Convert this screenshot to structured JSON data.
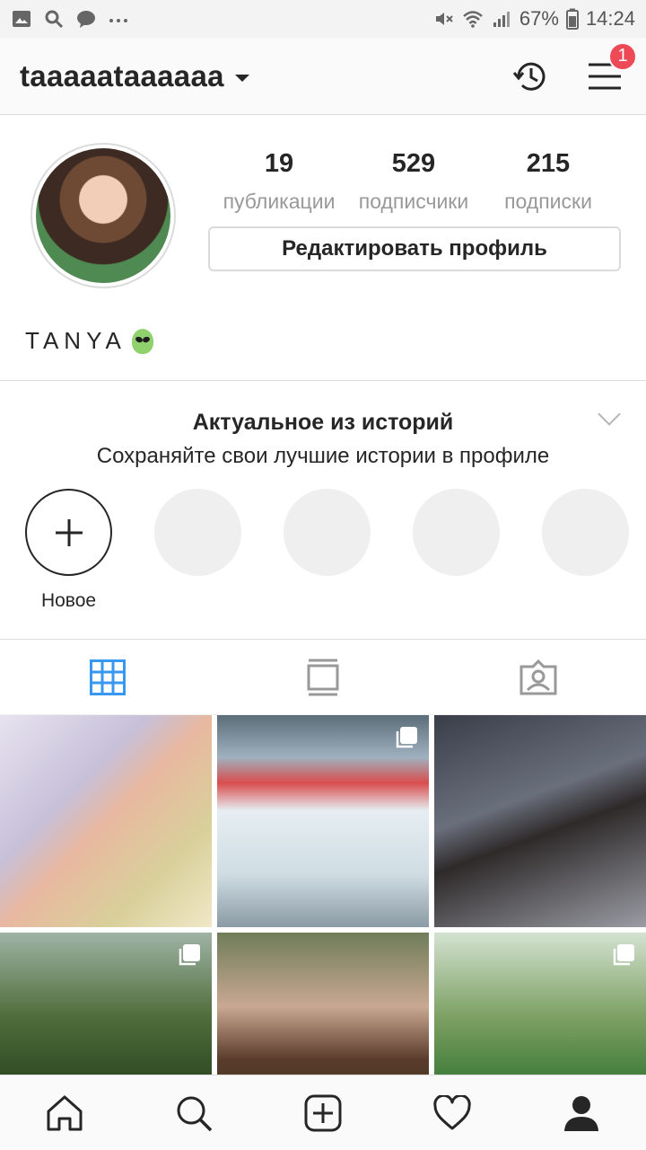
{
  "status_bar": {
    "battery": "67%",
    "time": "14:24",
    "icons": [
      "gallery-icon",
      "search-icon",
      "chat-icon",
      "more-icon",
      "mute-icon",
      "wifi-icon",
      "signal-icon",
      "battery-icon"
    ]
  },
  "header": {
    "username": "taaaaataaaaaa",
    "notification_badge": "1",
    "icons": [
      "archive-icon",
      "menu-icon"
    ]
  },
  "profile": {
    "stats": [
      {
        "value": "19",
        "label": "публикации"
      },
      {
        "value": "529",
        "label": "подписчики"
      },
      {
        "value": "215",
        "label": "подписки"
      }
    ],
    "edit_button": "Редактировать профиль",
    "bio_name": "TANYA"
  },
  "highlights": {
    "title": "Актуальное из историй",
    "subtitle": "Сохраняйте свои лучшие истории в профиле",
    "new_label": "Новое"
  },
  "tabs": [
    "grid-icon",
    "feed-icon",
    "tagged-icon"
  ],
  "bottom_nav": [
    "home-icon",
    "search-icon",
    "add-post-icon",
    "activity-icon",
    "profile-icon"
  ],
  "colors": {
    "accent_blue": "#3897f0",
    "badge_red": "#ed4956"
  }
}
